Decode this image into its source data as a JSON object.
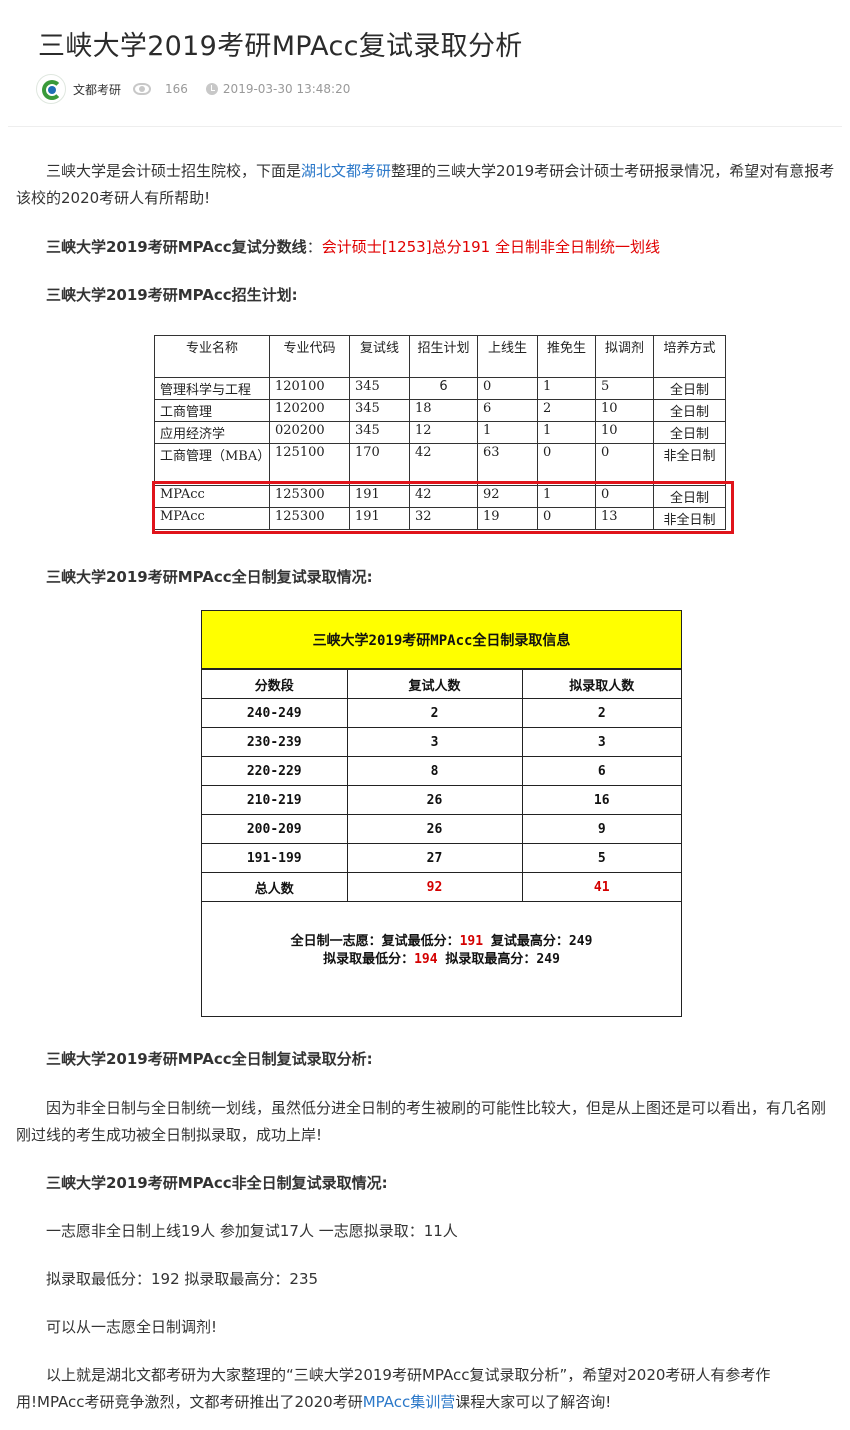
{
  "article": {
    "title": "三峡大学2019考研MPAcc复试录取分析",
    "author": "文都考研",
    "views": "166",
    "date": "2019-03-30 13:48:20"
  },
  "intro": {
    "part1": "三峡大学是会计硕士招生院校，下面是",
    "link": "湖北文都考研",
    "part2": "整理的三峡大学2019考研会计硕士考研报录情况，希望对有意报考该校的2020考研人有所帮助!"
  },
  "score_line": {
    "label": "三峡大学2019考研MPAcc复试分数线",
    "colon": "：",
    "value": "会计硕士[1253]总分191 全日制非全日制统一划线"
  },
  "plan_heading": "三峡大学2019考研MPAcc招生计划:",
  "plan_table": {
    "headers": [
      "专业名称",
      "专业代码",
      "复试线",
      "招生计划",
      "上线生",
      "推免生",
      "拟调剂",
      "培养方式"
    ],
    "rows": [
      [
        "管理科学与工程",
        "120100",
        "345",
        "6",
        "0",
        "1",
        "5",
        "全日制"
      ],
      [
        "工商管理",
        "120200",
        "345",
        "18",
        "6",
        "2",
        "10",
        "全日制"
      ],
      [
        "应用经济学",
        "020200",
        "345",
        "12",
        "1",
        "1",
        "10",
        "全日制"
      ],
      [
        "工商管理（MBA）",
        "125100",
        "170",
        "42",
        "63",
        "0",
        "0",
        "非全日制"
      ],
      [
        "MPAcc",
        "125300",
        "191",
        "42",
        "92",
        "1",
        "0",
        "全日制"
      ],
      [
        "MPAcc",
        "125300",
        "191",
        "32",
        "19",
        "0",
        "13",
        "非全日制"
      ]
    ]
  },
  "fulltime_heading": "三峡大学2019考研MPAcc全日制复试录取情况:",
  "admit_table": {
    "title": "三峡大学2019考研MPAcc全日制录取信息",
    "headers": [
      "分数段",
      "复试人数",
      "拟录取人数"
    ],
    "rows": [
      [
        "240-249",
        "2",
        "2"
      ],
      [
        "230-239",
        "3",
        "3"
      ],
      [
        "220-229",
        "8",
        "6"
      ],
      [
        "210-219",
        "26",
        "16"
      ],
      [
        "200-209",
        "26",
        "9"
      ],
      [
        "191-199",
        "27",
        "5"
      ]
    ],
    "total": [
      "总人数",
      "92",
      "41"
    ],
    "note1_label": "全日制一志愿：复试最低分：",
    "note1_min": "191",
    "note1_rest": " 复试最高分：249",
    "note2_label": "拟录取最低分：",
    "note2_min": "194",
    "note2_rest": " 拟录取最高分：249"
  },
  "analysis_heading": "三峡大学2019考研MPAcc全日制复试录取分析:",
  "analysis_text": "因为非全日制与全日制统一划线，虽然低分进全日制的考生被刷的可能性比较大，但是从上图还是可以看出，有几名刚刚过线的考生成功被全日制拟录取，成功上岸!",
  "parttime_heading": "三峡大学2019考研MPAcc非全日制复试录取情况:",
  "parttime_lines": [
    "一志愿非全日制上线19人 参加复试17人 一志愿拟录取：11人",
    "拟录取最低分：192 拟录取最高分：235",
    "可以从一志愿全日制调剂!"
  ],
  "closing": {
    "part1": "以上就是湖北文都考研为大家整理的“三峡大学2019考研MPAcc复试录取分析”，希望对2020考研人有参考作用!MPAcc考研竞争激烈，文都考研推出了2020考研",
    "link": "MPAcc集训营",
    "part2": "课程大家可以了解咨询!"
  },
  "colors": {
    "link": "#2b78c9",
    "red": "#e00000",
    "highlight_border": "#e0141b",
    "table_header_bg": "#ffff00"
  },
  "icons": [
    "logo",
    "eye-icon",
    "clock-icon"
  ]
}
